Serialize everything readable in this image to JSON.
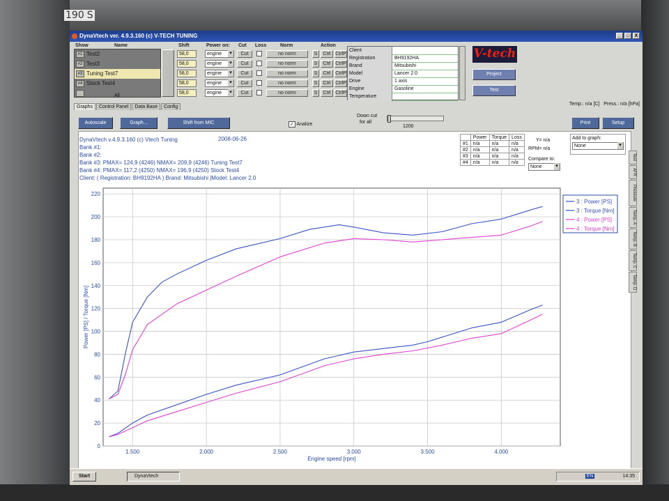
{
  "monitor": {
    "model_label": "190",
    "model_badge": "S"
  },
  "window": {
    "title": "DynaVtech ver. 4.9.3.160 (c) V-TECH TUNING",
    "minimize": "_",
    "maximize": "□",
    "close": "X"
  },
  "columns": {
    "show": "Show",
    "name": "Name",
    "shift": "Shift",
    "power_on": "Power on:",
    "cut": "Cut",
    "loss": "Loss",
    "norm": "Norm",
    "action": "Action"
  },
  "tests": [
    {
      "num": "#1",
      "name": "Test2",
      "shift": "58,0",
      "power_on": "engine",
      "cut": "Cut",
      "norm": "no norm"
    },
    {
      "num": "#2",
      "name": "Test3",
      "shift": "58,0",
      "power_on": "engine",
      "cut": "Cut",
      "norm": "no norm"
    },
    {
      "num": "#3",
      "name": "Tuning Test7",
      "shift": "58,0",
      "power_on": "engine",
      "cut": "Cut",
      "norm": "no norm"
    },
    {
      "num": "#4",
      "name": "Stock Test4",
      "shift": "58,0",
      "power_on": "engine",
      "cut": "Cut",
      "norm": "no norm"
    },
    {
      "num": "",
      "name": "",
      "shift": "58,0",
      "power_on": "engine",
      "cut": "Cut",
      "norm": "no norm"
    }
  ],
  "all_label": "All",
  "action_buttons": {
    "s": "S",
    "ctrl": "Ctrl",
    "ctrl_p": "CtrlP"
  },
  "client": [
    {
      "k": "Client",
      "v": ""
    },
    {
      "k": "Registration",
      "v": "BH9192HA"
    },
    {
      "k": "Brand",
      "v": "Mitsubishi"
    },
    {
      "k": "Model",
      "v": "Lancer 2.0"
    },
    {
      "k": "Drive",
      "v": "1 axis"
    },
    {
      "k": "Engine",
      "v": "Gasoline"
    },
    {
      "k": "Temperature",
      "v": ""
    }
  ],
  "logo": "V-tech",
  "side_buttons": {
    "project": "Project",
    "test": "Test"
  },
  "status": {
    "temp": "Temp.: n/a [C]",
    "press": "Press.: n/a [hPa]"
  },
  "tabs": [
    "Graphs",
    "Control Panel",
    "Data Base",
    "Config"
  ],
  "toolbar": {
    "autoscale": "Autoscale",
    "graph": "Graph...",
    "shift_from_mic": "Shift from MIC",
    "analize": "Analize",
    "down_cut": "Down cut",
    "for_all": "for all",
    "down_cut_value": "1200",
    "print": "Print",
    "setup": "Setup"
  },
  "info": {
    "line1": "DynaVtech v.4.9.3.160 (c) Vtech Tuning",
    "date": "2008-06-26",
    "bank1": "Bank #1:",
    "bank2": "Bank #2:",
    "bank3": "Bank #3:  PMAX= 124,9 (4246)    NMAX= 209,9 (4246)    Tuning Test7",
    "bank4": "Bank #4:  PMAX= 117,2 (4250)    NMAX= 196,9 (4250)    Stock Test4",
    "client": "Client:    ( Registration:  BH9192HA ) Brand: Mitsubishi |Model: Lancer 2.0"
  },
  "pt_table": {
    "headers": [
      "",
      "Power",
      "Torque",
      "Loss"
    ],
    "rows": [
      [
        "#1",
        "n/a",
        "n/a",
        "n/a"
      ],
      [
        "#2",
        "n/a",
        "n/a",
        "n/a"
      ],
      [
        "#3",
        "n/a",
        "n/a",
        "n/a"
      ],
      [
        "#4",
        "n/a",
        "n/a",
        "n/a"
      ]
    ],
    "y": "Y= n/a",
    "rpm": "RPM= n/a",
    "compare_to": "Compare to:",
    "compare_value": "None"
  },
  "add_to_graph": {
    "label": "Add to graph:",
    "value": "None"
  },
  "side_tabs": [
    "Test",
    "AFR",
    "Pressure",
    "Temp. A",
    "Temp. B",
    "Temp. C",
    "Temp. D"
  ],
  "taskbar": {
    "start": "Start",
    "task": "DynaVtech",
    "lang": "EN",
    "clock": "14:35"
  },
  "colors": {
    "series3": "#3a50c8",
    "series4": "#e040d0"
  },
  "chart_data": {
    "type": "line",
    "xlabel": "Engine speed [rpm]",
    "ylabel": "Power [PS] / Torque [Nm]",
    "xlim": [
      1300,
      4400
    ],
    "ylim": [
      0,
      225
    ],
    "x_ticks": [
      1500,
      2000,
      2500,
      3000,
      3500,
      4000
    ],
    "x_tick_labels": [
      "1.500",
      "2.000",
      "2.500",
      "3.000",
      "3.500",
      "4.000"
    ],
    "y_ticks": [
      0,
      20,
      40,
      60,
      80,
      100,
      120,
      140,
      160,
      180,
      200,
      220
    ],
    "grid": true,
    "legend": "top-right",
    "series": [
      {
        "name": "3 : Power [PS]",
        "x": [
          1340,
          1400,
          1500,
          1600,
          1800,
          2000,
          2200,
          2500,
          2800,
          2900,
          3000,
          3200,
          3400,
          3500,
          3800,
          4000,
          4200,
          4280
        ],
        "y": [
          8,
          11,
          20,
          27,
          36,
          45,
          53,
          62,
          76,
          79,
          82,
          85,
          88,
          91,
          103,
          108,
          119,
          123
        ]
      },
      {
        "name": "3 : Torque [Nm]",
        "x": [
          1340,
          1400,
          1450,
          1500,
          1600,
          1700,
          1800,
          2000,
          2200,
          2500,
          2700,
          2900,
          3000,
          3200,
          3400,
          3600,
          3800,
          4000,
          4200,
          4280
        ],
        "y": [
          41,
          48,
          80,
          108,
          130,
          143,
          150,
          162,
          172,
          181,
          189,
          193,
          191,
          186,
          184,
          187,
          194,
          198,
          206,
          209
        ]
      },
      {
        "name": "4 : Power [PS]",
        "x": [
          1340,
          1400,
          1500,
          1600,
          1800,
          2000,
          2200,
          2500,
          2800,
          3000,
          3200,
          3400,
          3600,
          3800,
          4000,
          4200,
          4280
        ],
        "y": [
          8,
          10,
          16,
          22,
          30,
          38,
          46,
          56,
          70,
          76,
          80,
          83,
          88,
          94,
          98,
          110,
          115
        ]
      },
      {
        "name": "4 : Torque [Nm]",
        "x": [
          1340,
          1400,
          1450,
          1500,
          1600,
          1800,
          2000,
          2200,
          2500,
          2800,
          3000,
          3200,
          3400,
          3600,
          3800,
          4000,
          4200,
          4280
        ],
        "y": [
          41,
          45,
          62,
          84,
          106,
          124,
          136,
          148,
          165,
          177,
          181,
          180,
          178,
          180,
          182,
          184,
          192,
          196
        ]
      }
    ]
  }
}
